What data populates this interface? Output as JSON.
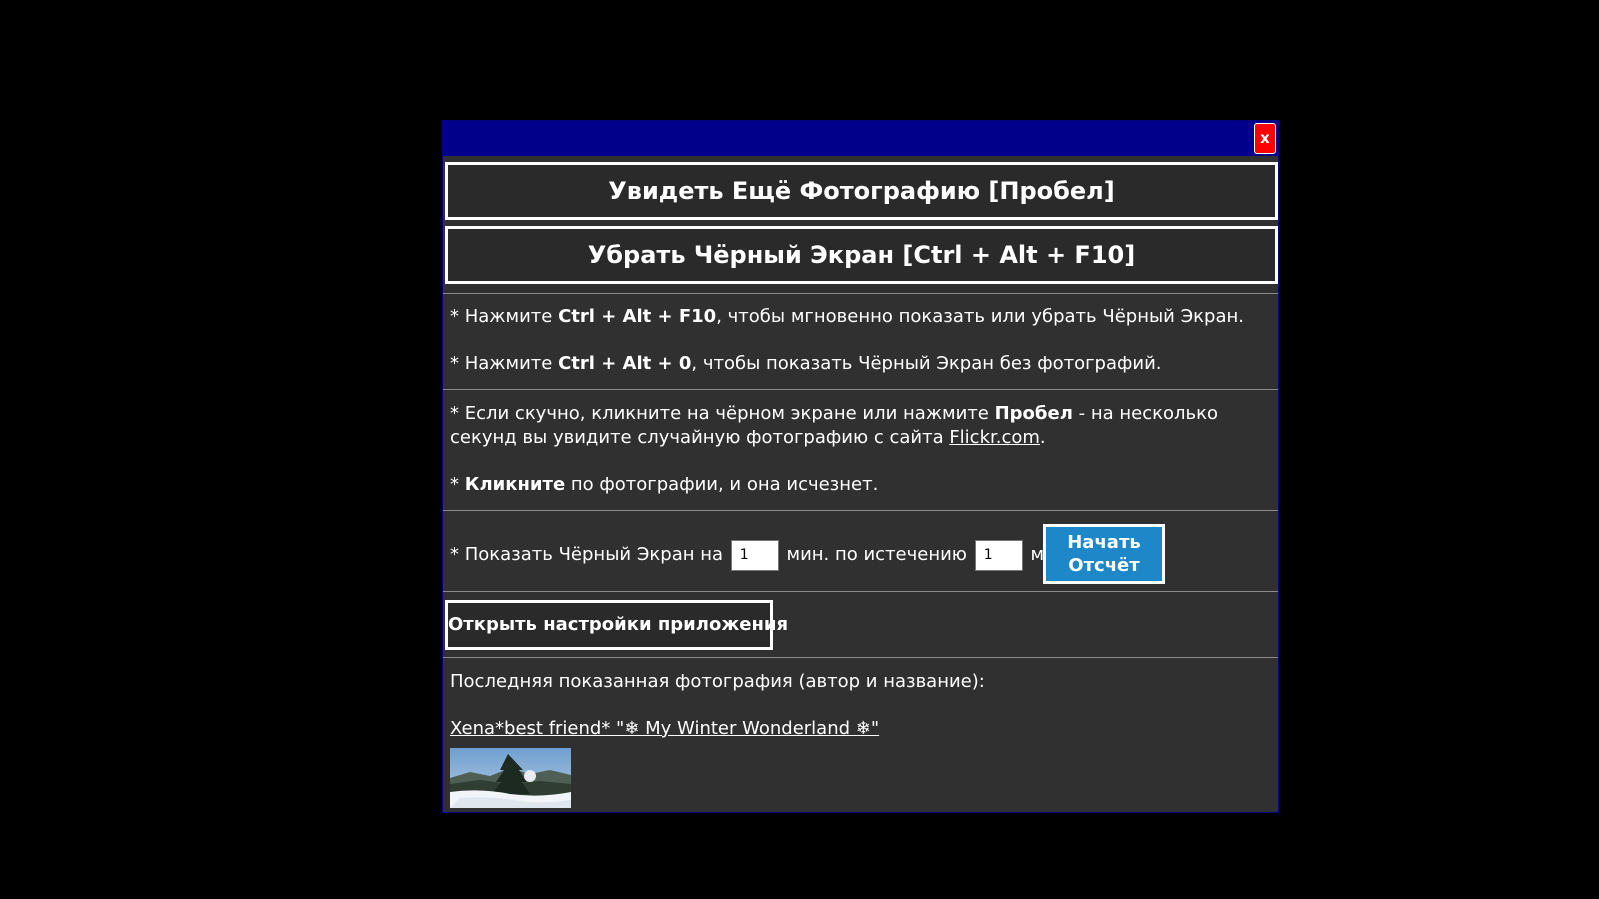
{
  "dialog": {
    "close_label": "x",
    "see_photo_button": "Увидеть Ещё Фотографию [Пробел]",
    "remove_black_screen_button": "Убрать Чёрный Экран [Ctrl + Alt + F10]"
  },
  "hints": {
    "line1": {
      "prefix": "* Нажмите ",
      "keys": "Ctrl + Alt + F10",
      "suffix": ", чтобы мгновенно показать или убрать Чёрный Экран."
    },
    "line2": {
      "prefix": "* Нажмите ",
      "keys": "Ctrl + Alt + 0",
      "suffix": ", чтобы показать Чёрный Экран без фотографий."
    },
    "line3": {
      "prefix": "* Если скучно, кликните на чёрном экране или нажмите ",
      "keys": "Пробел",
      "middle": " - на несколько секунд вы увидите случайную фотографию с сайта ",
      "link": "Flickr.com",
      "suffix": "."
    },
    "line4": {
      "prefix": "* ",
      "bold": "Кликните",
      "suffix": " по фотографии, и она исчезнет."
    }
  },
  "timer": {
    "label_show": "* Показать Чёрный Экран на",
    "show_minutes_value": "1",
    "label_after": "мин. по истечению",
    "after_minutes_value": "1",
    "label_min": "мин.",
    "start_button_line1": "Начать",
    "start_button_line2": "Отсчёт"
  },
  "settings_button": "Открыть настройки приложения",
  "last_photo": {
    "heading": "Последняя показанная фотография (автор и название):",
    "title_link": "Xena*best friend* \"❄ My Winter Wonderland ❄\""
  },
  "colors": {
    "background": "#000000",
    "dialog_bg": "#303030",
    "titlebar": "#00008b",
    "close_button": "#ff0000",
    "start_button": "#1e87c8"
  }
}
